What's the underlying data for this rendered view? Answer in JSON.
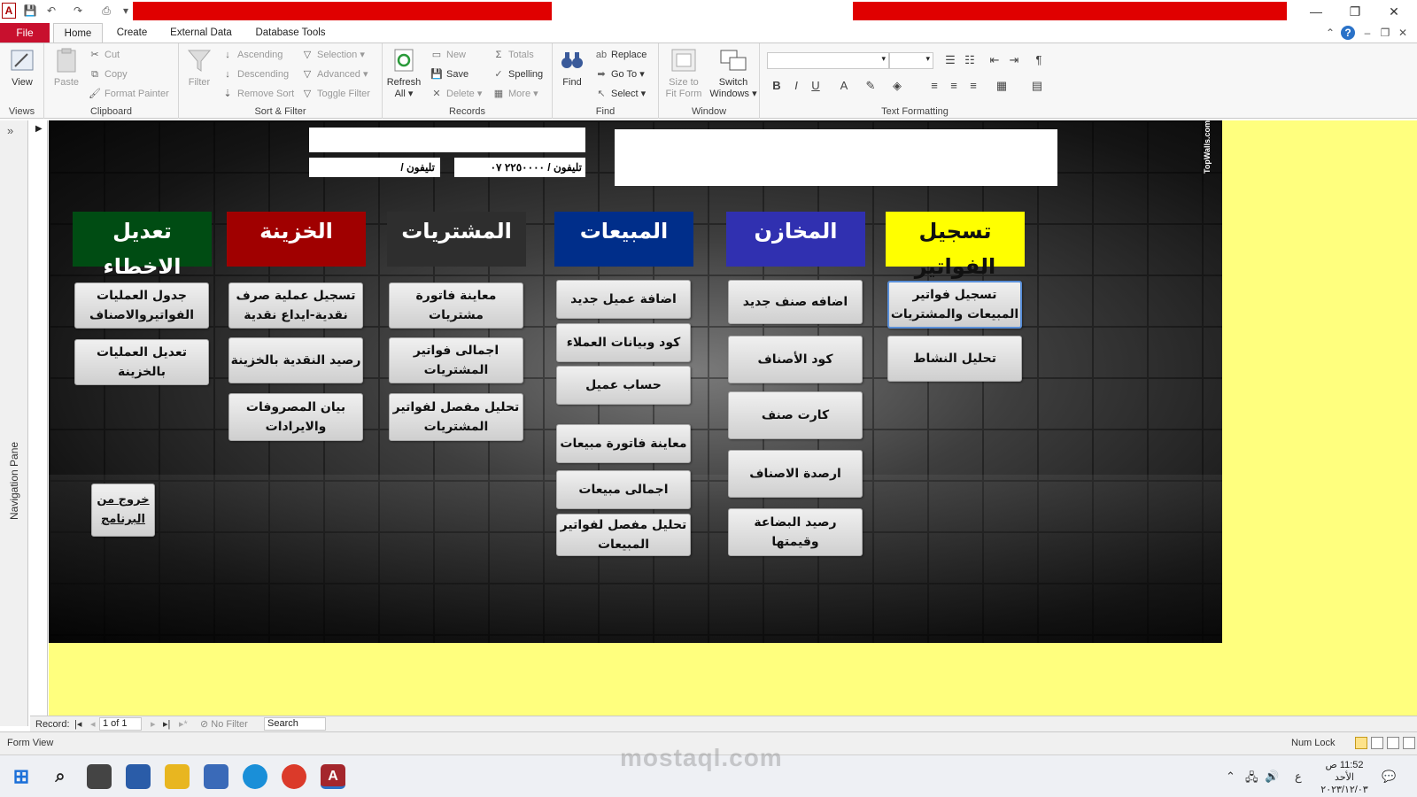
{
  "titlebar": {
    "app_icon": "A",
    "win_minimize": "—",
    "win_restore": "❐",
    "win_close": "✕"
  },
  "ribbon_tabs": {
    "file": "File",
    "home": "Home",
    "create": "Create",
    "external_data": "External Data",
    "database_tools": "Database Tools"
  },
  "ribbon": {
    "views": {
      "view": "View",
      "label": "Views"
    },
    "clipboard": {
      "paste": "Paste",
      "cut": "Cut",
      "copy": "Copy",
      "format_painter": "Format Painter",
      "label": "Clipboard"
    },
    "sort_filter": {
      "filter": "Filter",
      "ascending": "Ascending",
      "descending": "Descending",
      "remove_sort": "Remove Sort",
      "selection": "Selection",
      "advanced": "Advanced",
      "toggle_filter": "Toggle Filter",
      "label": "Sort & Filter"
    },
    "records": {
      "refresh": "Refresh",
      "refresh2": "All",
      "new": "New",
      "save": "Save",
      "delete": "Delete",
      "totals": "Totals",
      "spelling": "Spelling",
      "more": "More",
      "label": "Records"
    },
    "find": {
      "find": "Find",
      "replace": "Replace",
      "goto": "Go To",
      "select": "Select",
      "label": "Find"
    },
    "window": {
      "size_to_fit": "Size to",
      "size_to_fit2": "Fit Form",
      "switch_windows": "Switch",
      "switch_windows2": "Windows",
      "label": "Window"
    },
    "text_formatting": {
      "label": "Text Formatting"
    }
  },
  "nav": {
    "label": "Navigation Pane",
    "toggle": "»"
  },
  "form": {
    "side_watermark": "TopWalls.com",
    "phone_label_1": "تليفون /",
    "phone_label_2": "تليفون / ٢٢٥٠٠٠٠ ٠٧",
    "categories": [
      {
        "title": "تسجيل  الفواتير",
        "color": "#ffff00"
      },
      {
        "title": "المخازن",
        "color": "#3030b0"
      },
      {
        "title": "المبيعات",
        "color": "#002e8a"
      },
      {
        "title": "المشتريات",
        "color": "#2e2e2e"
      },
      {
        "title": "الخزينة",
        "color": "#a00000"
      },
      {
        "title": "تعديل الاخطاء",
        "color": "#004c13"
      }
    ],
    "buttons": {
      "invoices_reg": "تسجيل فواتير المبيعات والمشتريات",
      "activity_analysis": "تحليل النشاط",
      "add_item": "اضافه صنف جديد",
      "item_codes": "كود الأصناف",
      "item_card": "كارت صنف",
      "item_balances": "ارصدة الاصناف",
      "stock_value": "رصيد البضاعة وقيمتها",
      "add_customer": "اضافة عميل جديد",
      "customer_codes": "كود وبيانات العملاء",
      "customer_account": "حساب عميل",
      "sales_invoice_view": "معاينة فاتورة مبيعات",
      "total_sales": "اجمالى مبيعات",
      "sales_detail": "تحليل مفصل لفواتير المبيعات",
      "purchase_invoice_view": "معاينة فاتورة مشتريات",
      "total_purchases": "اجمالى فواتير المشتريات",
      "purchase_detail": "تحليل مفصل لفواتير المشتريات",
      "cash_op": "تسجيل عملية صرف نقدية-ايداع نقدية",
      "cash_balance": "رصيد النقدية بالخزينة",
      "expenses": "بيان المصروفات والايرادات",
      "ops_table": "جدول العمليات الفواتيروالاصناف",
      "edit_cash_ops": "تعديل العمليات بالخزينة",
      "exit": "خروج من البرنامج"
    }
  },
  "record_nav": {
    "record_label": "Record:",
    "first": "|◂",
    "prev": "◂",
    "position": "1 of 1",
    "next": "▸",
    "last": "▸|",
    "new": "▸*",
    "no_filter": "No Filter",
    "search": "Search"
  },
  "status": {
    "left": "Form View",
    "numlock": "Num Lock"
  },
  "taskbar": {
    "clock_time": "11:52 ص",
    "clock_day": "الأحد",
    "clock_date": "٢٠٢٣/١٢/٠٣",
    "lang": "ع"
  },
  "overlay": {
    "mostaql": "mostaql.com"
  }
}
